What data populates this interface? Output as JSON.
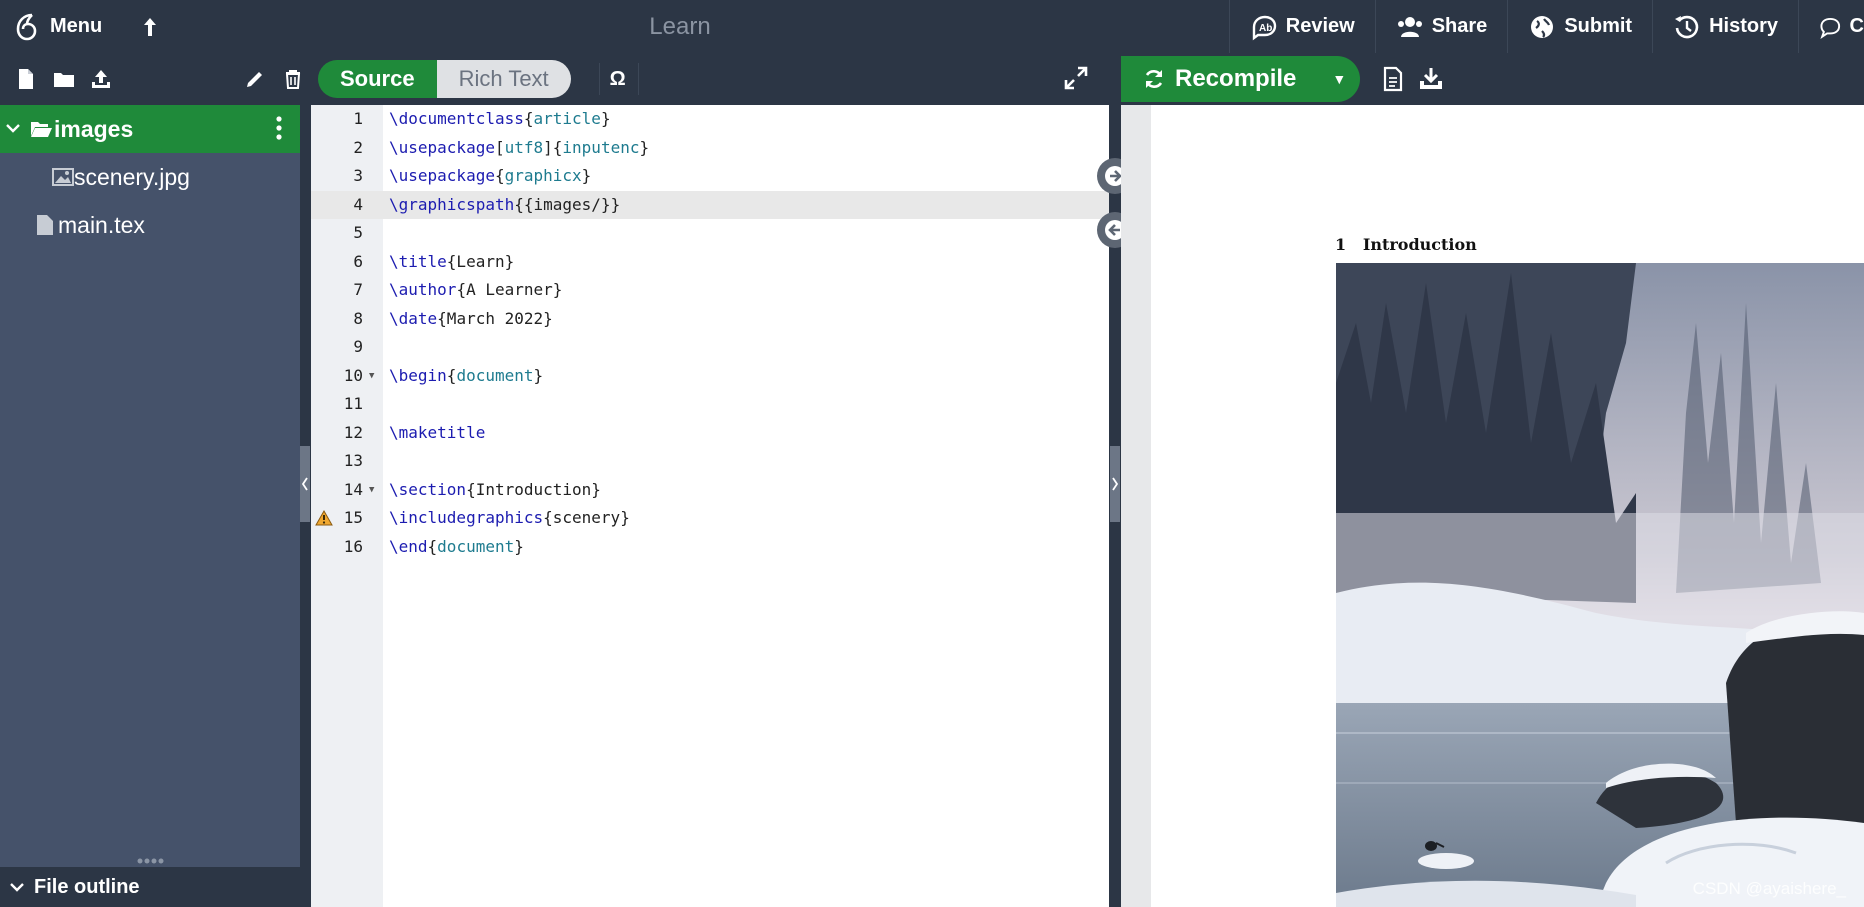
{
  "topbar": {
    "menu_label": "Menu",
    "title": "Learn",
    "actions": [
      {
        "label": "Review",
        "icon": "review-icon"
      },
      {
        "label": "Share",
        "icon": "share-users-icon"
      },
      {
        "label": "Submit",
        "icon": "globe-icon"
      },
      {
        "label": "History",
        "icon": "history-icon"
      },
      {
        "label": "C",
        "icon": "chat-icon"
      }
    ]
  },
  "editor_toolbar": {
    "source_label": "Source",
    "rich_text_label": "Rich Text",
    "symbol_label": "Ω"
  },
  "pdf_toolbar": {
    "recompile_label": "Recompile"
  },
  "file_tree": {
    "folder": "images",
    "items": [
      "scenery.jpg",
      "main.tex"
    ],
    "outline_label": "File outline"
  },
  "editor": {
    "lines": [
      {
        "n": "1",
        "parts": [
          [
            "kw",
            "\\documentclass"
          ],
          [
            "",
            "{"
          ],
          [
            "arg",
            "article"
          ],
          [
            "",
            "}"
          ]
        ]
      },
      {
        "n": "2",
        "parts": [
          [
            "kw",
            "\\usepackage"
          ],
          [
            "",
            "["
          ],
          [
            "arg",
            "utf8"
          ],
          [
            "",
            "]{"
          ],
          [
            "arg",
            "inputenc"
          ],
          [
            "",
            "}"
          ]
        ]
      },
      {
        "n": "3",
        "parts": [
          [
            "kw",
            "\\usepackage"
          ],
          [
            "",
            "{"
          ],
          [
            "arg",
            "graphicx"
          ],
          [
            "",
            "}"
          ]
        ]
      },
      {
        "n": "4",
        "parts": [
          [
            "kw",
            "\\graphicspath"
          ],
          [
            "",
            "{{images/}}"
          ]
        ]
      },
      {
        "n": "5",
        "parts": []
      },
      {
        "n": "6",
        "parts": [
          [
            "kw",
            "\\title"
          ],
          [
            "",
            "{Learn}"
          ]
        ]
      },
      {
        "n": "7",
        "parts": [
          [
            "kw",
            "\\author"
          ],
          [
            "",
            "{A Learner}"
          ]
        ]
      },
      {
        "n": "8",
        "parts": [
          [
            "kw",
            "\\date"
          ],
          [
            "",
            "{March 2022}"
          ]
        ]
      },
      {
        "n": "9",
        "parts": []
      },
      {
        "n": "10",
        "parts": [
          [
            "kw",
            "\\begin"
          ],
          [
            "",
            "{"
          ],
          [
            "arg",
            "document"
          ],
          [
            "",
            "}"
          ]
        ]
      },
      {
        "n": "11",
        "parts": []
      },
      {
        "n": "12",
        "parts": [
          [
            "kw",
            "\\maketitle"
          ]
        ]
      },
      {
        "n": "13",
        "parts": []
      },
      {
        "n": "14",
        "parts": [
          [
            "kw",
            "\\section"
          ],
          [
            "",
            "{Introduction}"
          ]
        ]
      },
      {
        "n": "15",
        "parts": [
          [
            "kw",
            "\\includegraphics"
          ],
          [
            "",
            "{scenery}"
          ]
        ]
      },
      {
        "n": "16",
        "parts": [
          [
            "kw",
            "\\end"
          ],
          [
            "",
            "{"
          ],
          [
            "arg",
            "document"
          ],
          [
            "",
            "}"
          ]
        ]
      }
    ]
  },
  "pdf": {
    "section_number": "1",
    "section_title": "Introduction",
    "watermark": "CSDN @ayaishere_"
  },
  "colors": {
    "accent_green": "#1f8a3a",
    "topbar_bg": "#2c3645",
    "sidebar_bg": "#45526a"
  }
}
